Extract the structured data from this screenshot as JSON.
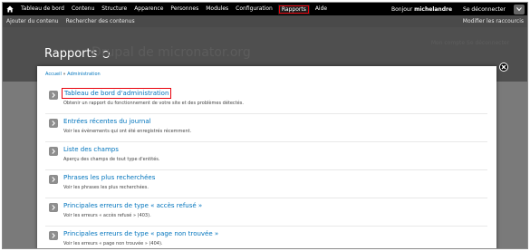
{
  "toolbar": {
    "menu": [
      {
        "label": "Tableau de bord"
      },
      {
        "label": "Contenu"
      },
      {
        "label": "Structure"
      },
      {
        "label": "Apparence"
      },
      {
        "label": "Personnes"
      },
      {
        "label": "Modules"
      },
      {
        "label": "Configuration"
      },
      {
        "label": "Rapports"
      },
      {
        "label": "Aide"
      }
    ],
    "active_item": "Rapports",
    "greeting_prefix": "Bonjour ",
    "username": "michelandre",
    "logout": "Se déconnecter"
  },
  "shortcuts": {
    "items": [
      {
        "label": "Ajouter du contenu"
      },
      {
        "label": "Rechercher des contenus"
      }
    ],
    "edit": "Modifier les raccourcis"
  },
  "background": {
    "title": "Rapports",
    "site_name": "Drupal de micronator.org",
    "links": "Mon compte    Se déconnecter"
  },
  "overlay": {
    "breadcrumb": [
      "Accueil",
      "Administration"
    ],
    "breadcrumb_sep": "»",
    "items": [
      {
        "title": "Tableau de bord d'administration",
        "desc": "Obtenir un rapport du fonctionnement de votre site et des problèmes détectés."
      },
      {
        "title": "Entrées récentes du journal",
        "desc": "Voir les évènements qui ont été enregistrés récemment."
      },
      {
        "title": "Liste des champs",
        "desc": "Aperçu des champs de tout type d'entités."
      },
      {
        "title": "Phrases les plus recherchées",
        "desc": "Voir les phrases les plus recherchées."
      },
      {
        "title": "Principales erreurs de type « accès refusé »",
        "desc": "Voir les erreurs « accès refusé » (403)."
      },
      {
        "title": "Principales erreurs de type « page non trouvée »",
        "desc": "Voir les erreurs « page non trouvée » (404)."
      }
    ]
  },
  "colors": {
    "toolbar_bg": "#000000",
    "shortcut_bg": "#4a4a4a",
    "link": "#0074bd",
    "highlight": "#e8000b"
  }
}
